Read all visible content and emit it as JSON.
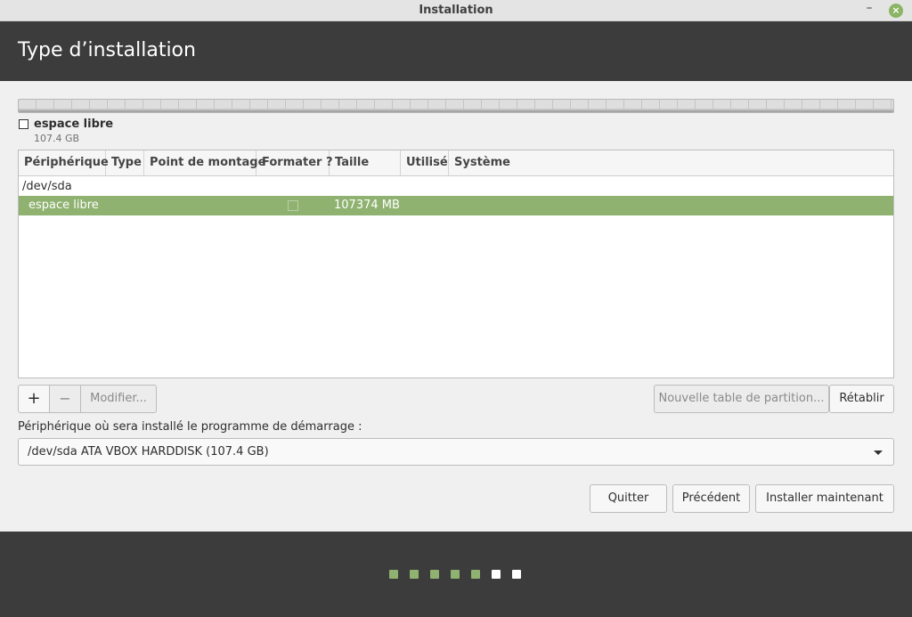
{
  "window": {
    "title": "Installation",
    "minimize_glyph": "–",
    "close_glyph": "×"
  },
  "header": {
    "title": "Type d’installation"
  },
  "disk_legend": {
    "name": "espace libre",
    "size": "107.4 GB"
  },
  "table": {
    "columns": [
      "Périphérique",
      "Type",
      "Point de montage",
      "Formater ?",
      "Taille",
      "Utilisé",
      "Système"
    ],
    "device": "/dev/sda",
    "rows": [
      {
        "device": "espace libre",
        "type": "",
        "mount": "",
        "format": false,
        "size": "107374 MB",
        "used": "",
        "system": ""
      }
    ]
  },
  "partition_buttons": {
    "add": "+",
    "remove": "−",
    "modify": "Modifier...",
    "new_table": "Nouvelle table de partition...",
    "revert": "Rétablir"
  },
  "bootloader": {
    "label": "Périphérique où sera installé le programme de démarrage :",
    "selected": "/dev/sda ATA VBOX HARDDISK (107.4 GB)"
  },
  "actions": {
    "quit": "Quitter",
    "back": "Précédent",
    "install": "Installer maintenant"
  },
  "progress": {
    "total_steps": 7,
    "completed_steps": 5
  },
  "colors": {
    "accent": "#8fb271",
    "header_bg": "#3c3c3c",
    "window_bg": "#f0f0f0"
  }
}
